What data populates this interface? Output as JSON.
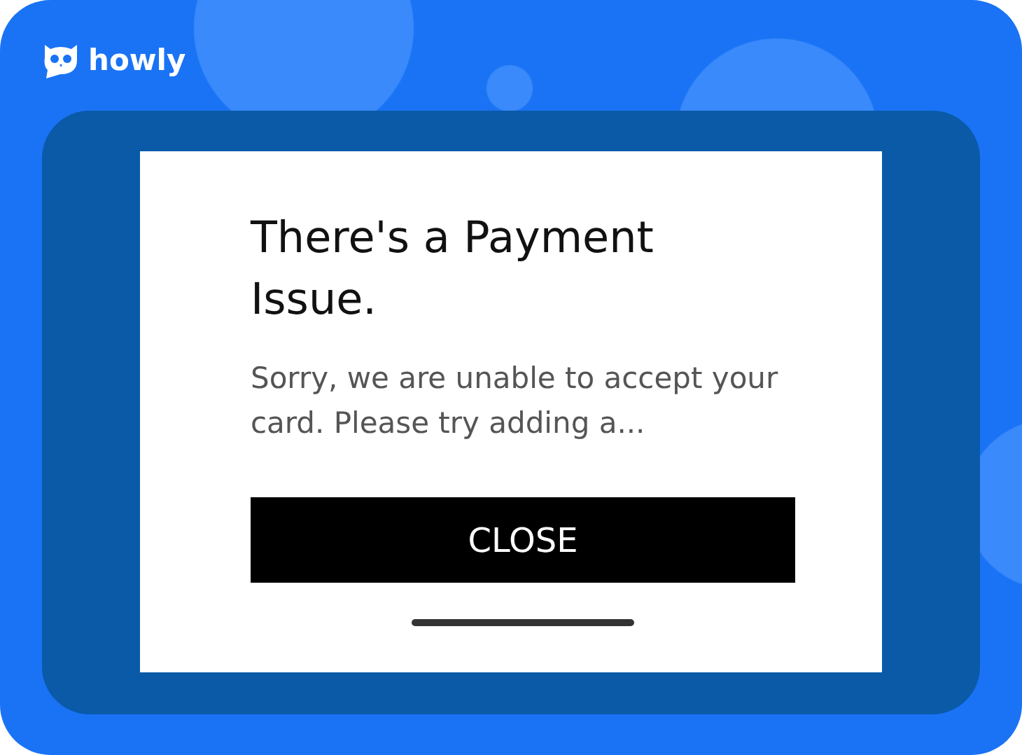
{
  "brand": {
    "name": "howly"
  },
  "dialog": {
    "title": "There's a Payment Issue.",
    "message": "Sorry, we are unable to accept your card. Please try adding a...",
    "button": "CLOSE"
  }
}
